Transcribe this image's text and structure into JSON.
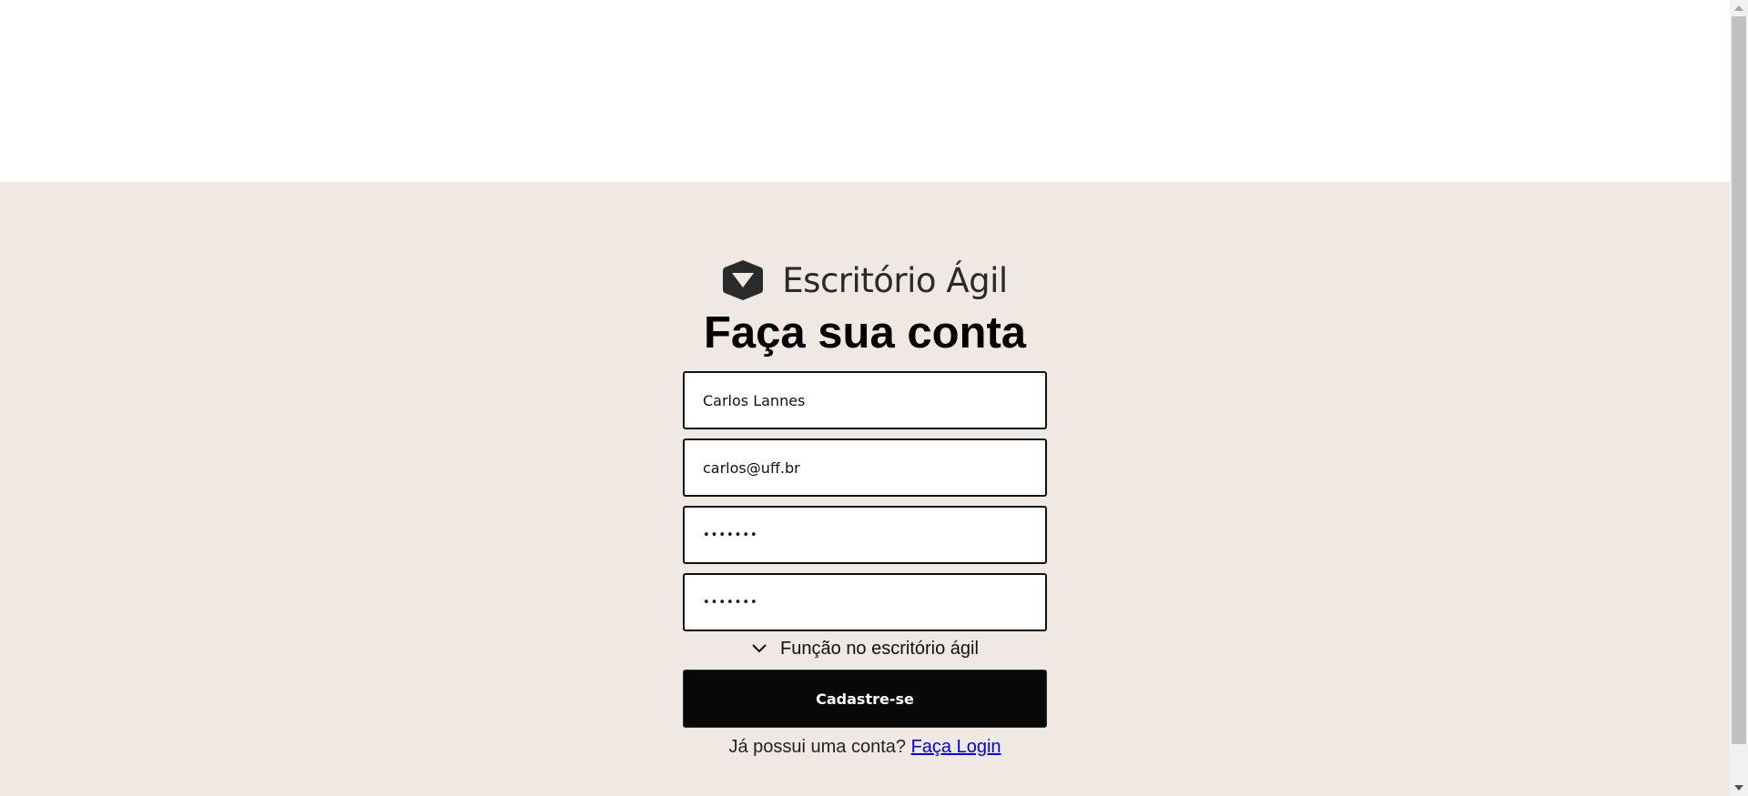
{
  "brand": {
    "name": "Escritório Ágil",
    "icon": "shield-chevron-logo-icon"
  },
  "form": {
    "title": "Faça sua conta",
    "name_value": "Carlos Lannes",
    "email_value": "carlos@uff.br",
    "password_value": "•••••••",
    "confirm_password_value": "•••••••",
    "role_label": "Função no escritório ágil",
    "submit_label": "Cadastre-se"
  },
  "login_prompt": {
    "text": "Já possui uma conta?",
    "link_label": "Faça Login"
  },
  "colors": {
    "page_background": "#f0e8e3",
    "button_background": "#080808",
    "link": "#0000ee"
  }
}
